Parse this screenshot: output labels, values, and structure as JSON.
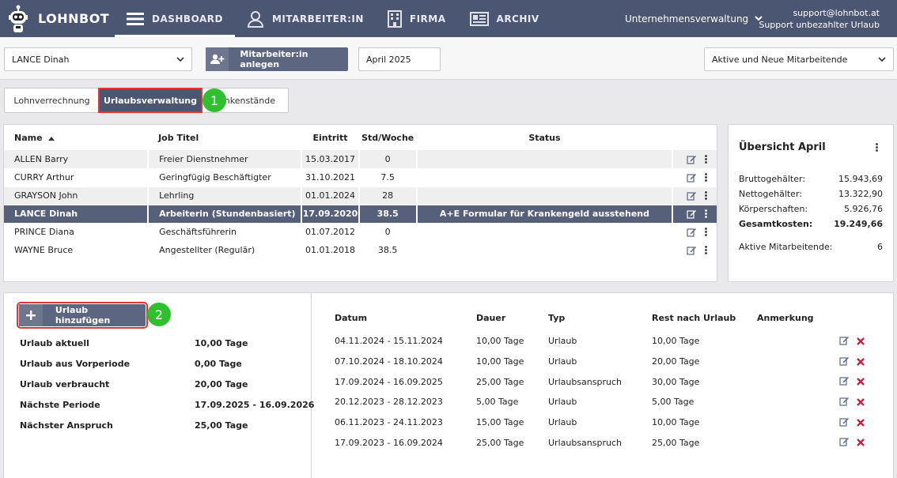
{
  "brand": {
    "name": "LOHNBOT"
  },
  "nav": {
    "items": [
      {
        "label": "DASHBOARD",
        "icon": "menu-icon"
      },
      {
        "label": "MITARBEITER:IN",
        "icon": "user-icon"
      },
      {
        "label": "FIRMA",
        "icon": "building-icon"
      },
      {
        "label": "ARCHIV",
        "icon": "archive-icon"
      }
    ],
    "company_menu": "Unternehmensverwaltung",
    "user_email": "support@lohnbot.at",
    "user_name": "Support unbezahlter Urlaub"
  },
  "filters": {
    "employee": "LANCE Dinah",
    "create_button": "Mitarbeiter:in anlegen",
    "period": "April 2025",
    "status_filter": "Aktive und Neue Mitarbeitende"
  },
  "tabs": {
    "payroll": "Lohnverrechnung",
    "vacation": "Urlaubsverwaltung",
    "sick": "Krankenstände"
  },
  "markers": {
    "one": "1",
    "two": "2"
  },
  "employees": {
    "headers": {
      "name": "Name",
      "job": "Job Titel",
      "entry": "Eintritt",
      "hours": "Std/Woche",
      "status": "Status"
    },
    "rows": [
      {
        "name": "ALLEN Barry",
        "job": "Freier Dienstnehmer",
        "entry": "15.03.2017",
        "hours": "0",
        "status": ""
      },
      {
        "name": "CURRY Arthur",
        "job": "Geringfügig Beschäftigter",
        "entry": "31.10.2021",
        "hours": "7.5",
        "status": ""
      },
      {
        "name": "GRAYSON John",
        "job": "Lehrling",
        "entry": "01.01.2024",
        "hours": "28",
        "status": ""
      },
      {
        "name": "LANCE Dinah",
        "job": "Arbeiterin (Stundenbasiert)",
        "entry": "17.09.2020",
        "hours": "38.5",
        "status": "A+E Formular für Krankengeld ausstehend"
      },
      {
        "name": "PRINCE Diana",
        "job": "Geschäftsführerin",
        "entry": "01.07.2012",
        "hours": "0",
        "status": ""
      },
      {
        "name": "WAYNE Bruce",
        "job": "Angestellter (Regulär)",
        "entry": "01.01.2018",
        "hours": "38.5",
        "status": ""
      }
    ]
  },
  "summary": {
    "title": "Übersicht April",
    "rows": [
      {
        "label": "Bruttogehälter:",
        "value": "15.943,69"
      },
      {
        "label": "Nettogehälter:",
        "value": "13.322,90"
      },
      {
        "label": "Körperschaften:",
        "value": "5.926,76"
      },
      {
        "label": "Gesamtkosten:",
        "value": "19.249,66"
      }
    ],
    "active_label": "Aktive Mitarbeitende:",
    "active_value": "6"
  },
  "vacation": {
    "add_button": "Urlaub hinzufügen",
    "stats": [
      {
        "label": "Urlaub aktuell",
        "value": "10,00 Tage"
      },
      {
        "label": "Urlaub aus Vorperiode",
        "value": "0,00 Tage"
      },
      {
        "label": "Urlaub verbraucht",
        "value": "20,00 Tage"
      },
      {
        "label": "Nächste Periode",
        "value": "17.09.2025 - 16.09.2026"
      },
      {
        "label": "Nächster Anspruch",
        "value": "25,00 Tage"
      }
    ],
    "headers": {
      "date": "Datum",
      "duration": "Dauer",
      "type": "Typ",
      "rest": "Rest nach Urlaub",
      "note": "Anmerkung"
    },
    "entries": [
      {
        "date": "04.11.2024 - 15.11.2024",
        "duration": "10,00 Tage",
        "type": "Urlaub",
        "rest": "10,00 Tage"
      },
      {
        "date": "07.10.2024 - 18.10.2024",
        "duration": "10,00 Tage",
        "type": "Urlaub",
        "rest": "20,00 Tage"
      },
      {
        "date": "17.09.2024 - 16.09.2025",
        "duration": "25,00 Tage",
        "type": "Urlaubsanspruch",
        "rest": "30,00 Tage"
      },
      {
        "date": "20.12.2023 - 28.12.2023",
        "duration": "5,00 Tage",
        "type": "Urlaub",
        "rest": "5,00 Tage"
      },
      {
        "date": "06.11.2023 - 24.11.2023",
        "duration": "15,00 Tage",
        "type": "Urlaub",
        "rest": "10,00 Tage"
      },
      {
        "date": "17.09.2023 - 16.09.2024",
        "duration": "25,00 Tage",
        "type": "Urlaubsanspruch",
        "rest": "25,00 Tage"
      }
    ]
  },
  "colors": {
    "navbar": "#4b5672",
    "selected_row": "#56607a",
    "marker": "#2fbf2f",
    "highlight": "#e03636",
    "delete": "#c0244a"
  }
}
